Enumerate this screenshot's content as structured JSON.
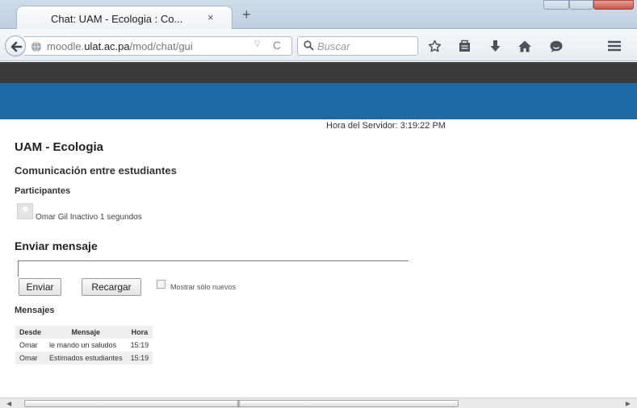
{
  "browser": {
    "tab_title": "Chat: UAM - Ecologia : Co...",
    "tab_close": "×",
    "new_tab": "+",
    "url_prefix": "moodle.",
    "url_domain": "ulat.ac.pa",
    "url_path": "/mod/chat/gui",
    "search_placeholder": "Buscar"
  },
  "page": {
    "server_time": "Hora del Servidor: 3:19:22 PM",
    "course_title": "UAM - Ecologia",
    "chat_name": "Comunicación entre estudiantes",
    "participants_heading": "Participantes",
    "participant_status": "Omar Gil Inactivo 1 segundos",
    "send_heading": "Enviar mensaje",
    "message_value": "",
    "send_button": "Enviar",
    "reload_button": "Recargar",
    "only_new_label": "Mostrar sólo nuevos",
    "only_new_checked": false,
    "messages_heading": "Mensajes",
    "columns": [
      "Desde",
      "Mensaje",
      "Hora"
    ],
    "rows": [
      [
        "Omar",
        "le mando un saludos",
        "15:19"
      ],
      [
        "Omar",
        "Estimados estudiantes",
        "15:19"
      ]
    ]
  },
  "colors": {
    "dark_bar": "#3a3a3a",
    "brand_bar": "#1f6aa5"
  },
  "icons": [
    "back-arrow-icon",
    "globe-icon",
    "dropdown-icon",
    "reload-icon",
    "search-icon",
    "star-icon",
    "reading-list-icon",
    "download-icon",
    "home-icon",
    "hello-chat-icon",
    "menu-icon"
  ]
}
